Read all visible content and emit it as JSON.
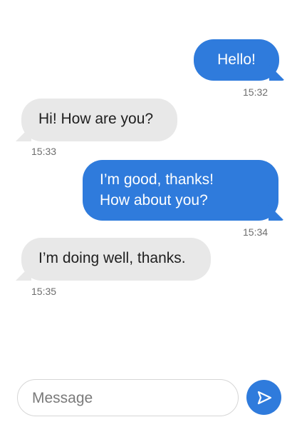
{
  "messages": [
    {
      "direction": "outgoing",
      "text": "Hello!",
      "time": "15:32"
    },
    {
      "direction": "incoming",
      "text": "Hi! How are you?",
      "time": "15:33"
    },
    {
      "direction": "outgoing",
      "text": "I’m good, thanks!\nHow about you?",
      "time": "15:34"
    },
    {
      "direction": "incoming",
      "text": "I’m doing well, thanks.",
      "time": "15:35"
    }
  ],
  "composer": {
    "placeholder": "Message",
    "value": ""
  },
  "send_button": {
    "icon": "send-icon"
  },
  "colors": {
    "outgoing_bubble": "#2f7bdc",
    "incoming_bubble": "#e8e8e8",
    "send_button": "#2f7bdc",
    "timestamp": "#6d6d6d"
  }
}
